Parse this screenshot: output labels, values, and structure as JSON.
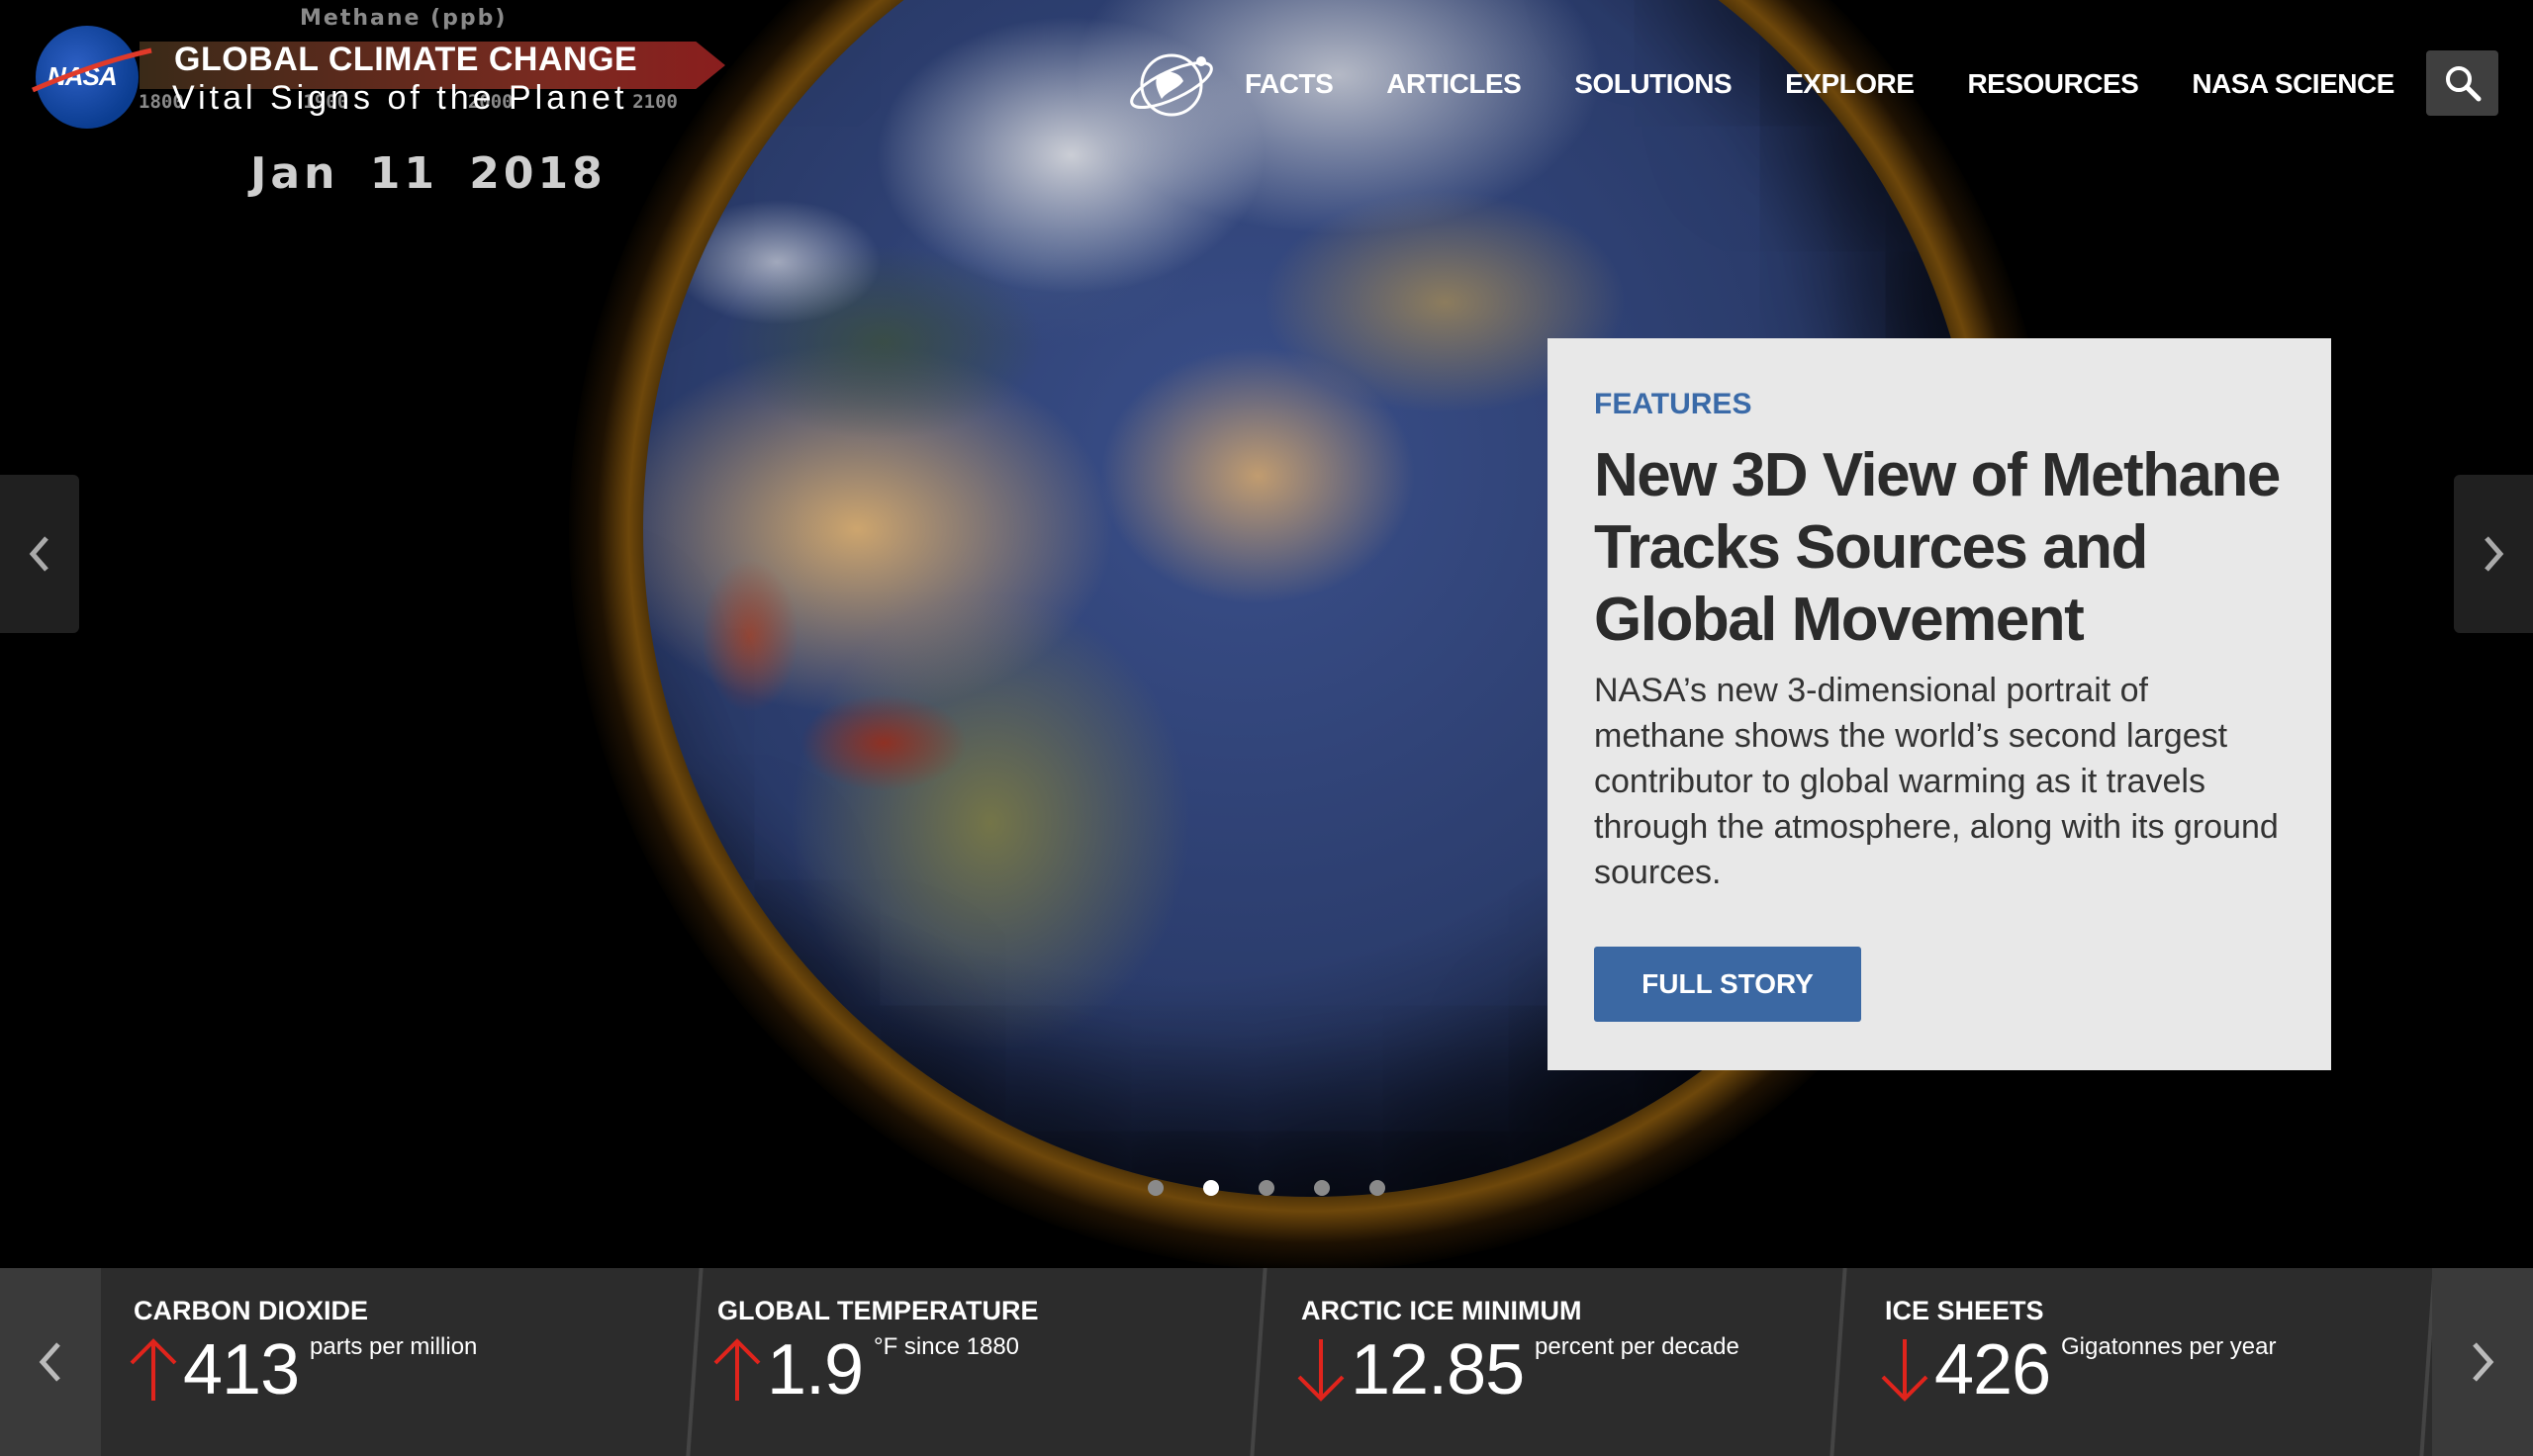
{
  "video_overlay": {
    "label": "Methane (ppb)",
    "scale": [
      "1800",
      "1900",
      "2000",
      "2100"
    ],
    "date": "Jan 11 2018"
  },
  "logo": {
    "agency": "NASA",
    "title": "GLOBAL CLIMATE CHANGE",
    "subtitle": "Vital Signs of the Planet"
  },
  "nav": {
    "items": [
      "FACTS",
      "ARTICLES",
      "SOLUTIONS",
      "EXPLORE",
      "RESOURCES",
      "NASA SCIENCE"
    ]
  },
  "feature": {
    "kicker": "FEATURES",
    "title": "New 3D View of Methane Tracks Sources and Global Movement",
    "body": "NASA’s new 3-dimensional portrait of methane shows the world’s second largest contributor to global warming as it travels through the atmosphere, along with its ground sources.",
    "button": "FULL STORY"
  },
  "carousel": {
    "total": 5,
    "active": 2
  },
  "vitals": [
    {
      "title": "CARBON DIOXIDE",
      "trend": "up",
      "value": "413",
      "unit": "parts per million"
    },
    {
      "title": "GLOBAL TEMPERATURE",
      "trend": "up",
      "value": "1.9",
      "unit": "°F since 1880"
    },
    {
      "title": "ARCTIC ICE MINIMUM",
      "trend": "down",
      "value": "12.85",
      "unit": "percent per decade"
    },
    {
      "title": "ICE SHEETS",
      "trend": "down",
      "value": "426",
      "unit": "Gigatonnes per year"
    }
  ],
  "colors": {
    "accent_blue": "#3b68a3",
    "trend_red": "#e0241c",
    "card_bg": "#e8e8e8"
  },
  "icons": {
    "search": "search-icon",
    "prev": "chevron-left-icon",
    "next": "chevron-right-icon",
    "site": "climate-globe-icon"
  }
}
